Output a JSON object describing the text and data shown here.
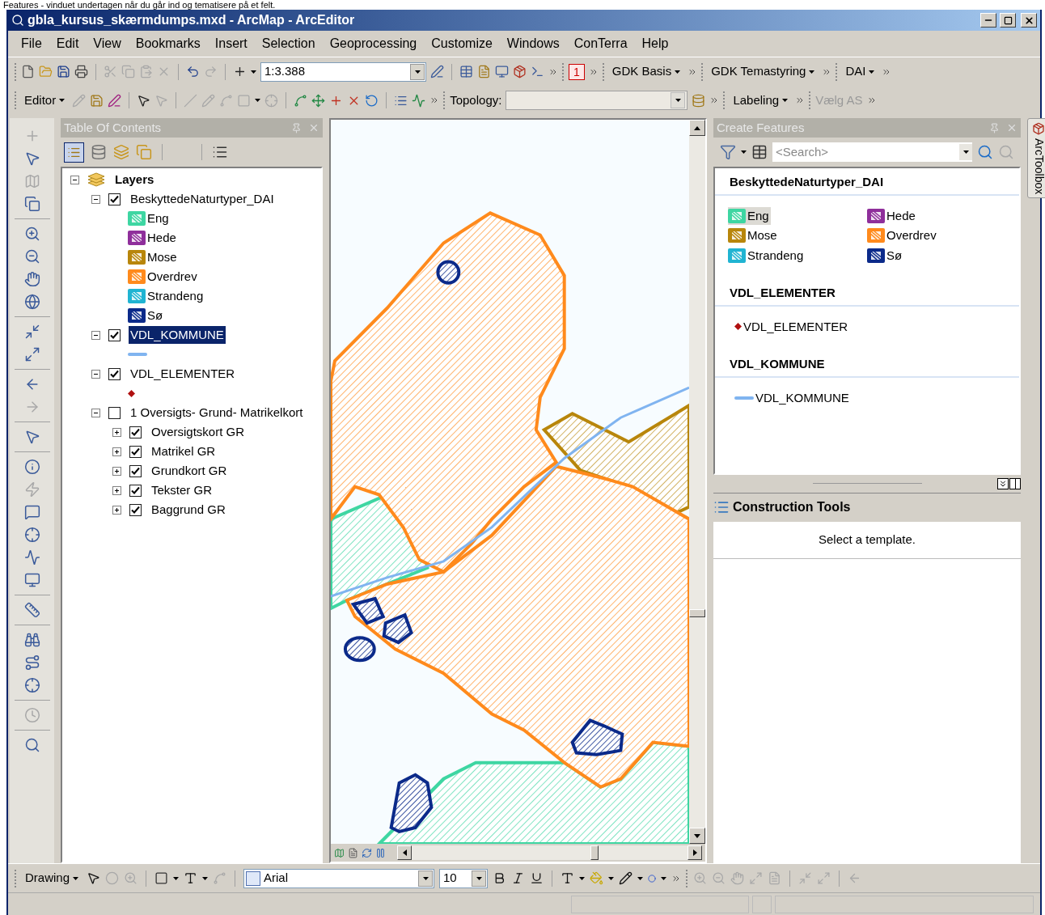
{
  "caption": "Features - vinduet undertagen når du går ind og tematisere på et felt.",
  "window": {
    "title": "gbla_kursus_skærmdumps.mxd - ArcMap - ArcEditor"
  },
  "menu": [
    "File",
    "Edit",
    "View",
    "Bookmarks",
    "Insert",
    "Selection",
    "Geoprocessing",
    "Customize",
    "Windows",
    "ConTerra",
    "Help"
  ],
  "toolbar_1": {
    "scale": "1:3.388",
    "page_number": "1",
    "menus": [
      "GDK Basis",
      "GDK Temastyring",
      "DAI"
    ]
  },
  "toolbar_2": {
    "editor": "Editor",
    "topology_label": "Topology:",
    "labeling": "Labeling",
    "select_label": "Vælg AS"
  },
  "toc": {
    "title": "Table Of Contents",
    "tree": [
      {
        "label": "Layers",
        "kind": "frame",
        "expanded": true,
        "checked": true,
        "selected": false,
        "children": [
          {
            "label": "BeskyttedeNaturtyper_DAI",
            "checked": true,
            "expanded": true,
            "selected": false,
            "legend": [
              {
                "kind": "fill",
                "label": "Eng",
                "color": "#3ed6a2"
              },
              {
                "kind": "fill",
                "label": "Hede",
                "color": "#8f2f9b"
              },
              {
                "kind": "fill",
                "label": "Mose",
                "color": "#b8860b"
              },
              {
                "kind": "fill",
                "label": "Overdrev",
                "color": "#ff8a1c"
              },
              {
                "kind": "fill",
                "label": "Strandeng",
                "color": "#20b4d2"
              },
              {
                "kind": "fill",
                "label": "Sø",
                "color": "#0b2a8a"
              }
            ]
          },
          {
            "label": "VDL_KOMMUNE",
            "checked": true,
            "expanded": true,
            "selected": true,
            "legend": [
              {
                "kind": "line",
                "color": "#80b4f0"
              }
            ]
          },
          {
            "label": "VDL_ELEMENTER",
            "checked": true,
            "expanded": true,
            "selected": false,
            "legend": [
              {
                "kind": "point",
                "color": "#b01010"
              }
            ]
          },
          {
            "label": "1 Oversigts- Grund- Matrikelkort",
            "checked": false,
            "expanded": true,
            "selected": false,
            "children": [
              {
                "label": "Oversigtskort GR",
                "checked": true,
                "expanded": false,
                "selected": false
              },
              {
                "label": "Matrikel GR",
                "checked": true,
                "expanded": false,
                "selected": false
              },
              {
                "label": "Grundkort GR",
                "checked": true,
                "expanded": false,
                "selected": false
              },
              {
                "label": "Tekster GR",
                "checked": true,
                "expanded": false,
                "selected": false
              },
              {
                "label": "Baggrund GR",
                "checked": true,
                "expanded": false,
                "selected": false
              }
            ]
          }
        ]
      }
    ]
  },
  "create_features": {
    "title": "Create Features",
    "search_placeholder": "<Search>",
    "groups": [
      {
        "title": "BeskyttedeNaturtyper_DAI",
        "kind": "fill",
        "items": [
          {
            "label": "Eng",
            "color": "#3ed6a2",
            "selected": true
          },
          {
            "label": "Hede",
            "color": "#8f2f9b",
            "selected": false
          },
          {
            "label": "Mose",
            "color": "#b8860b",
            "selected": false
          },
          {
            "label": "Overdrev",
            "color": "#ff8a1c",
            "selected": false
          },
          {
            "label": "Strandeng",
            "color": "#20b4d2",
            "selected": false
          },
          {
            "label": "Sø",
            "color": "#0b2a8a",
            "selected": false
          }
        ]
      },
      {
        "title": "VDL_ELEMENTER",
        "kind": "point",
        "items": [
          {
            "label": "VDL_ELEMENTER",
            "color": "#b01010",
            "selected": false
          }
        ]
      },
      {
        "title": "VDL_KOMMUNE",
        "kind": "line",
        "items": [
          {
            "label": "VDL_KOMMUNE",
            "color": "#80b4f0",
            "selected": false
          }
        ]
      }
    ]
  },
  "construction_tools": {
    "title": "Construction Tools",
    "message": "Select a template."
  },
  "side_tab": "ArcToolbox",
  "drawing_toolbar": {
    "label": "Drawing",
    "font": "Arial",
    "font_size": "10"
  }
}
